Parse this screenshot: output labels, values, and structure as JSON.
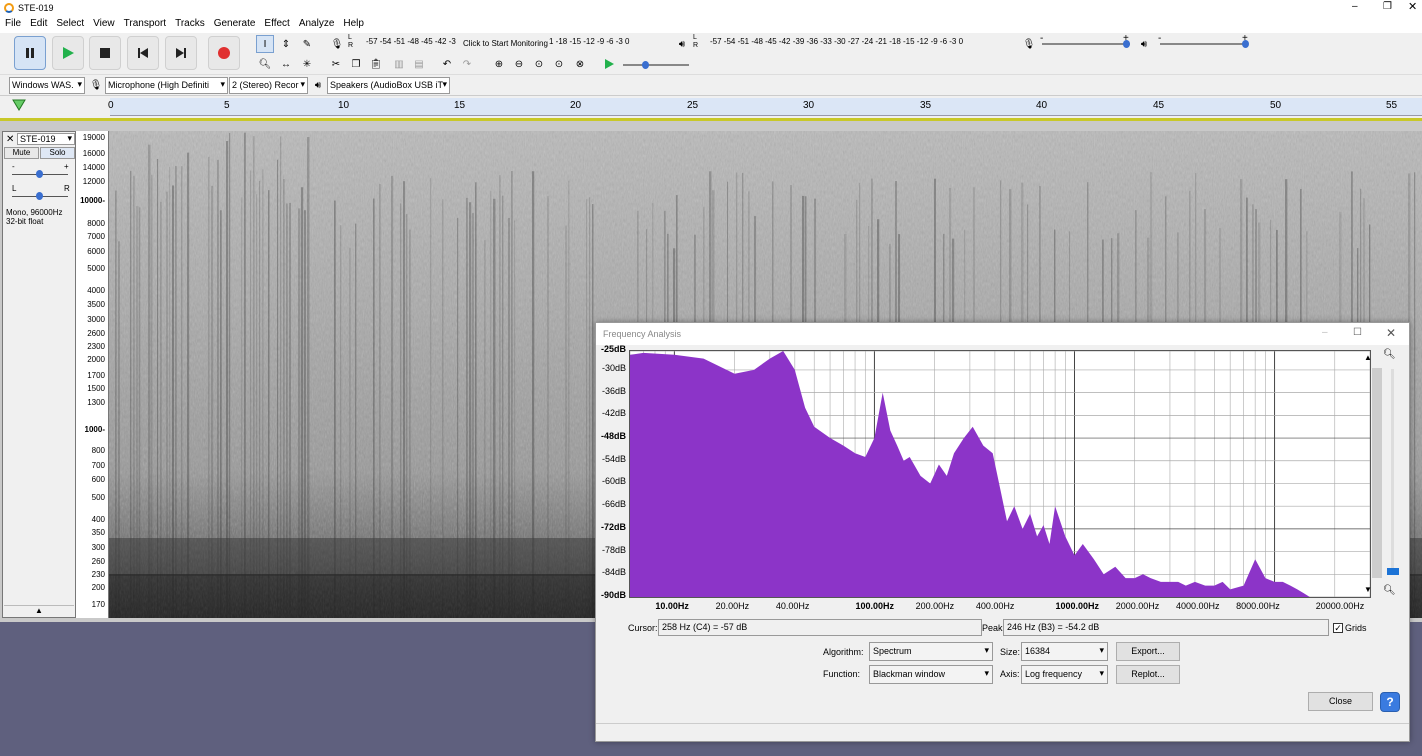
{
  "window": {
    "title": "STE-019"
  },
  "menu": [
    "File",
    "Edit",
    "Select",
    "View",
    "Transport",
    "Tracks",
    "Generate",
    "Effect",
    "Analyze",
    "Help"
  ],
  "meters": {
    "record_scale": "-57 -54 -51 -48 -45 -42 -3",
    "record_hint": "Click to Start Monitoring",
    "record_scale2": "1 -18 -15 -12 -9 -6 -3 0",
    "play_scale": "-57 -54 -51 -48 -45 -42 -39 -36 -33 -30 -27 -24 -21 -18 -15 -12 -9 -6 -3 0",
    "rec_minus": "-",
    "rec_plus": "+",
    "play_minus": "-",
    "play_plus": "+"
  },
  "devices": {
    "host": "Windows WAS.",
    "input": "Microphone (High Definiti",
    "channels": "2 (Stereo) Recor",
    "output": "Speakers (AudioBox USB iT"
  },
  "ruler": [
    "0",
    "5",
    "10",
    "15",
    "20",
    "25",
    "30",
    "35",
    "40",
    "45",
    "50",
    "55"
  ],
  "track": {
    "name": "STE-019",
    "mute": "Mute",
    "solo": "Solo",
    "gain_minus": "-",
    "gain_plus": "+",
    "pan_l": "L",
    "pan_r": "R",
    "info1": "Mono, 96000Hz",
    "info2": "32-bit float"
  },
  "freq_scale": [
    "19000",
    "16000",
    "14000",
    "12000",
    "10000-",
    "8000",
    "7000",
    "6000",
    "5000",
    "4000",
    "3500",
    "3000",
    "2600",
    "2300",
    "2000",
    "1700",
    "1500",
    "1300",
    "1000-",
    "800",
    "700",
    "600",
    "500",
    "400",
    "350",
    "300",
    "260",
    "230",
    "200",
    "170"
  ],
  "dialog": {
    "title": "Frequency Analysis",
    "cursor_label": "Cursor:",
    "cursor_value": "258 Hz (C4) = -57 dB",
    "peak_label": "Peak:",
    "peak_value": "246 Hz (B3) = -54.2 dB",
    "grids_label": "Grids",
    "algorithm_label": "Algorithm:",
    "algorithm_value": "Spectrum",
    "size_label": "Size:",
    "size_value": "16384",
    "function_label": "Function:",
    "function_value": "Blackman window",
    "axis_label": "Axis:",
    "axis_value": "Log frequency",
    "export": "Export...",
    "replot": "Replot...",
    "close": "Close",
    "help": "?"
  },
  "chart_data": {
    "type": "area",
    "xscale": "log",
    "xlim": [
      6,
      30000
    ],
    "ylim": [
      -90,
      -25
    ],
    "color": "#8c34c8",
    "ytick_labels": [
      "-25dB",
      "-30dB",
      "-36dB",
      "-42dB",
      "-48dB",
      "-54dB",
      "-60dB",
      "-66dB",
      "-72dB",
      "-78dB",
      "-84dB",
      "-90dB"
    ],
    "xtick_labels": [
      "10.00Hz",
      "20.00Hz",
      "40.00Hz",
      "100.00Hz",
      "200.00Hz",
      "400.00Hz",
      "1000.00Hz",
      "2000.00Hz",
      "4000.00Hz",
      "8000.00Hz",
      "20000.00Hz"
    ],
    "x": [
      6,
      7,
      10,
      14,
      20,
      25,
      30,
      35,
      40,
      45,
      50,
      60,
      70,
      80,
      90,
      100,
      110,
      120,
      130,
      140,
      150,
      170,
      190,
      210,
      230,
      250,
      280,
      310,
      350,
      390,
      420,
      460,
      500,
      550,
      600,
      650,
      700,
      750,
      800,
      900,
      1000,
      1100,
      1250,
      1400,
      1600,
      1800,
      2000,
      2200,
      2400,
      2700,
      3000,
      3300,
      3600,
      4000,
      4500,
      5000,
      5500,
      6000,
      7000,
      8000,
      9000,
      10000,
      11000,
      12000,
      13000,
      14000,
      15000,
      16000
    ],
    "y": [
      -26,
      -25.5,
      -26,
      -27,
      -31,
      -30,
      -27,
      -25,
      -30,
      -40,
      -45,
      -48,
      -50,
      -52,
      -53,
      -48,
      -36,
      -46,
      -50,
      -54,
      -53,
      -58,
      -60,
      -55,
      -58,
      -52,
      -48,
      -45,
      -50,
      -52,
      -60,
      -70,
      -66,
      -72,
      -68,
      -74,
      -71,
      -76,
      -66,
      -74,
      -79,
      -76,
      -80,
      -84,
      -82,
      -85,
      -85,
      -84,
      -85,
      -86,
      -86,
      -86,
      -87,
      -86,
      -87,
      -87,
      -86,
      -88,
      -87,
      -80,
      -85,
      -86,
      -86,
      -87,
      -88,
      -89,
      -90,
      -90
    ]
  }
}
